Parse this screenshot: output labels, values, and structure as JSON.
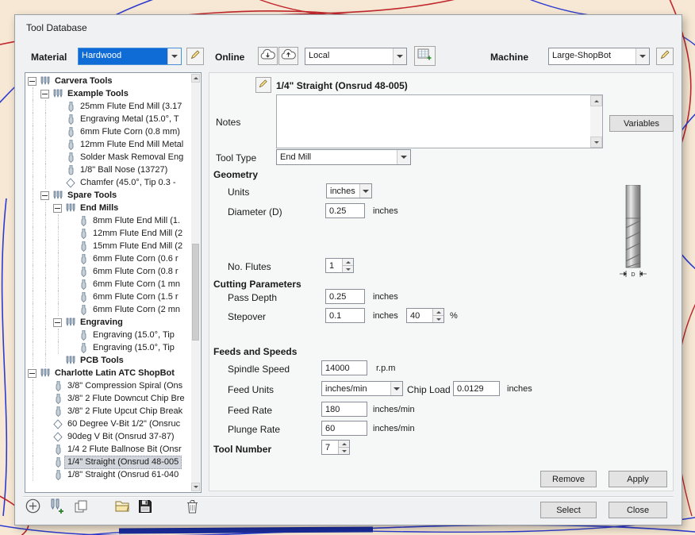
{
  "window": {
    "title": "Tool Database"
  },
  "colors": {
    "focus_blue": "#0f6cd6",
    "tree_selection": "#d2d6dc",
    "curve_red": "#c1272d",
    "curve_blue": "#2e3bd0"
  },
  "header": {
    "material_label": "Material",
    "material_value": "Hardwood",
    "material_edit_icon": "pencil-edit-icon",
    "online_label": "Online",
    "cloud_download_icon": "cloud-download-icon",
    "cloud_upload_icon": "cloud-upload-icon",
    "source_value": "Local",
    "database_add_icon": "database-add-icon",
    "machine_label": "Machine",
    "machine_value": "Large-ShopBot",
    "machine_edit_icon": "pencil-edit-icon"
  },
  "tree": {
    "items": [
      {
        "label": "Carvera Tools",
        "level": 0,
        "bold": true,
        "expander": true,
        "icon": "tool-group-icon"
      },
      {
        "label": "Example Tools",
        "level": 1,
        "bold": true,
        "expander": true,
        "icon": "tool-group-icon"
      },
      {
        "label": "25mm Flute End Mill (3.17",
        "level": 2,
        "icon": "end-mill-icon"
      },
      {
        "label": "Engraving Metal (15.0°, T",
        "level": 2,
        "icon": "end-mill-icon"
      },
      {
        "label": "6mm Flute Corn (0.8 mm)",
        "level": 2,
        "icon": "end-mill-icon"
      },
      {
        "label": "12mm Flute End Mill Metal",
        "level": 2,
        "icon": "end-mill-icon"
      },
      {
        "label": "Solder Mask Removal Eng",
        "level": 2,
        "icon": "end-mill-icon"
      },
      {
        "label": "1/8\" Ball Nose (13727)",
        "level": 2,
        "icon": "ball-nose-icon"
      },
      {
        "label": "Chamfer (45.0°, Tip 0.3 -",
        "level": 2,
        "icon": "v-bit-icon"
      },
      {
        "label": "Spare Tools",
        "level": 1,
        "bold": true,
        "expander": true,
        "icon": "tool-group-icon"
      },
      {
        "label": "End Mills",
        "level": 2,
        "bold": true,
        "expander": true,
        "icon": "tool-group-icon"
      },
      {
        "label": "8mm Flute End Mill (1.",
        "level": 3,
        "icon": "end-mill-icon"
      },
      {
        "label": "12mm Flute End Mill (2",
        "level": 3,
        "icon": "end-mill-icon"
      },
      {
        "label": "15mm Flute End Mill (2",
        "level": 3,
        "icon": "end-mill-icon"
      },
      {
        "label": "6mm Flute Corn (0.6 r",
        "level": 3,
        "icon": "end-mill-icon"
      },
      {
        "label": "6mm Flute Corn (0.8 r",
        "level": 3,
        "icon": "end-mill-icon"
      },
      {
        "label": "6mm Flute Corn (1 mn",
        "level": 3,
        "icon": "end-mill-icon"
      },
      {
        "label": "6mm Flute Corn (1.5 r",
        "level": 3,
        "icon": "end-mill-icon"
      },
      {
        "label": "6mm Flute Corn (2 mn",
        "level": 3,
        "icon": "end-mill-icon"
      },
      {
        "label": "Engraving",
        "level": 2,
        "bold": true,
        "expander": true,
        "icon": "tool-group-icon"
      },
      {
        "label": "Engraving (15.0°, Tip",
        "level": 3,
        "icon": "end-mill-icon"
      },
      {
        "label": "Engraving (15.0°, Tip",
        "level": 3,
        "icon": "end-mill-icon"
      },
      {
        "label": "PCB Tools",
        "level": 2,
        "bold": true,
        "icon": "tool-group-icon"
      },
      {
        "label": "Charlotte Latin ATC ShopBot",
        "level": 0,
        "bold": true,
        "expander": true,
        "icon": "tool-group-icon"
      },
      {
        "label": "3/8\" Compression Spiral  (Ons",
        "level": 1,
        "icon": "end-mill-icon"
      },
      {
        "label": "3/8\" 2 Flute Downcut Chip Bre",
        "level": 1,
        "icon": "end-mill-icon"
      },
      {
        "label": "3/8\" 2 Flute Upcut Chip Break",
        "level": 1,
        "icon": "end-mill-icon"
      },
      {
        "label": "60 Degree V-Bit 1/2\"  (Onsruc",
        "level": 1,
        "icon": "v-bit-icon"
      },
      {
        "label": "90deg V Bit (Onsrud 37-87)",
        "level": 1,
        "icon": "v-bit-icon"
      },
      {
        "label": "1/4 2 Flute Ballnose Bit (Onsr",
        "level": 1,
        "icon": "end-mill-icon"
      },
      {
        "label": "1/4\" Straight  (Onsrud 48-005",
        "level": 1,
        "icon": "end-mill-icon",
        "selected": true
      },
      {
        "label": "1/8\" Straight  (Onsrud 61-040",
        "level": 1,
        "icon": "end-mill-icon"
      }
    ]
  },
  "detail": {
    "edit_icon": "pencil-edit-icon",
    "title": "1/4\" Straight  (Onsrud 48-005)",
    "notes_label": "Notes",
    "notes_value": "",
    "variables_button": "Variables",
    "tool_type_label": "Tool Type",
    "tool_type_value": "End Mill",
    "geometry_header": "Geometry",
    "units_label": "Units",
    "units_value": "inches",
    "diameter_label": "Diameter (D)",
    "diameter_value": "0.25",
    "diameter_unit": "inches",
    "diameter_dim_label": "D",
    "flutes_label": "No. Flutes",
    "flutes_value": "1",
    "cutting_header": "Cutting Parameters",
    "pass_depth_label": "Pass Depth",
    "pass_depth_value": "0.25",
    "pass_depth_unit": "inches",
    "stepover_label": "Stepover",
    "stepover_value": "0.1",
    "stepover_unit": "inches",
    "stepover_percent_value": "40",
    "stepover_percent_unit": "%",
    "feeds_header": "Feeds and Speeds",
    "spindle_label": "Spindle Speed",
    "spindle_value": "14000",
    "spindle_unit": "r.p.m",
    "feed_units_label": "Feed Units",
    "feed_units_value": "inches/min",
    "chip_load_label": "Chip Load",
    "chip_load_value": "0.0129",
    "chip_load_unit": "inches",
    "feed_rate_label": "Feed Rate",
    "feed_rate_value": "180",
    "feed_rate_unit": "inches/min",
    "plunge_rate_label": "Plunge Rate",
    "plunge_rate_value": "60",
    "plunge_rate_unit": "inches/min",
    "tool_number_label": "Tool Number",
    "tool_number_value": "7",
    "remove_button": "Remove",
    "apply_button": "Apply"
  },
  "footer": {
    "select_button": "Select",
    "close_button": "Close",
    "toolbar_icons": [
      "add-tool-icon",
      "add-tool-group-icon",
      "copy-tool-icon",
      "open-database-icon",
      "save-database-icon",
      "delete-tool-icon"
    ]
  }
}
